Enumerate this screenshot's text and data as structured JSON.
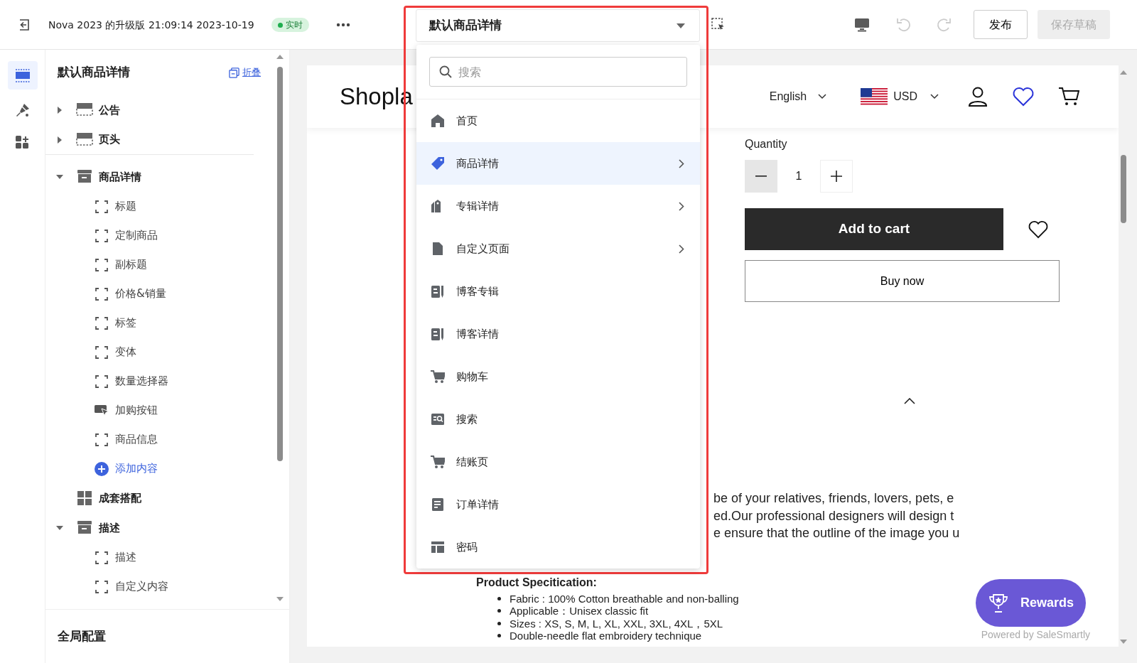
{
  "topbar": {
    "title": "Nova 2023 的升级版 21:09:14 2023-10-19",
    "status": "实时",
    "publish": {
      "label": "发布",
      "disabled": false
    },
    "save": {
      "label": "保存草稿",
      "disabled": true
    }
  },
  "rail": [
    {
      "kind": "sections",
      "selected": true
    },
    {
      "kind": "theme",
      "selected": false
    },
    {
      "kind": "apps",
      "selected": false
    }
  ],
  "sidebar": {
    "title": "默认商品详情",
    "collapse_label": "折叠",
    "groups": [
      {
        "label": "公告",
        "kind": "bar",
        "expanded": false,
        "divider_after": false
      },
      {
        "label": "页头",
        "kind": "bar",
        "expanded": false,
        "divider_after": true
      },
      {
        "label": "商品详情",
        "kind": "box",
        "expanded": true,
        "divider_after": false,
        "children": [
          {
            "label": "标题",
            "kind": "frame"
          },
          {
            "label": "定制商品",
            "kind": "frame"
          },
          {
            "label": "副标题",
            "kind": "frame"
          },
          {
            "label": "价格&销量",
            "kind": "frame"
          },
          {
            "label": "标签",
            "kind": "frame"
          },
          {
            "label": "变体",
            "kind": "frame"
          },
          {
            "label": "数量选择器",
            "kind": "frame"
          },
          {
            "label": "加购按钮",
            "kind": "cursor"
          },
          {
            "label": "商品信息",
            "kind": "frame"
          },
          {
            "label": "添加内容",
            "kind": "add"
          }
        ]
      },
      {
        "label": "成套搭配",
        "kind": "grid",
        "divider_after": false
      },
      {
        "label": "描述",
        "kind": "box",
        "expanded": true,
        "divider_after": false,
        "children": [
          {
            "label": "描述",
            "kind": "frame"
          },
          {
            "label": "自定义内容",
            "kind": "frame"
          }
        ]
      }
    ],
    "footer": "全局配置"
  },
  "dropdown": {
    "value": "默认商品详情",
    "highlighted": true,
    "search_placeholder": "搜索",
    "items": [
      {
        "label": "首页",
        "kind": "home",
        "submenu": false,
        "selected": false
      },
      {
        "label": "商品详情",
        "kind": "tag",
        "submenu": true,
        "selected": true
      },
      {
        "label": "专辑详情",
        "kind": "tags",
        "submenu": true,
        "selected": false
      },
      {
        "label": "自定义页面",
        "kind": "file",
        "submenu": true,
        "selected": false
      },
      {
        "label": "博客专辑",
        "kind": "blog",
        "submenu": false,
        "selected": false
      },
      {
        "label": "博客详情",
        "kind": "blog",
        "submenu": false,
        "selected": false
      },
      {
        "label": "购物车",
        "kind": "cart",
        "submenu": false,
        "selected": false
      },
      {
        "label": "搜索",
        "kind": "search",
        "submenu": false,
        "selected": false
      },
      {
        "label": "结账页",
        "kind": "cart",
        "submenu": false,
        "selected": false
      },
      {
        "label": "订单详情",
        "kind": "order",
        "submenu": false,
        "selected": false
      },
      {
        "label": "密码",
        "kind": "layout",
        "submenu": false,
        "selected": false
      }
    ]
  },
  "preview": {
    "logo": "Shopla",
    "language": "English",
    "currency": "USD",
    "quantity_label": "Quantity",
    "quantity": "1",
    "add_to_cart": "Add to cart",
    "buy_now": "Buy now",
    "description_lines": [
      "be of your relatives, friends, lovers, pets, e",
      "ed.Our professional designers will design t",
      "e ensure that the outline of the image you u"
    ],
    "spec_heading": "Product Specitication:",
    "spec_items": [
      "Fabric : 100% Cotton breathable and non-balling",
      "Applicable：Unisex classic fit",
      "Sizes : XS, S, M, L, XL, XXL, 3XL, 4XL，5XL",
      "Double-needle flat embroidery technique"
    ],
    "rewards": "Rewards",
    "powered_by": "Powered by SaleSmartly"
  }
}
